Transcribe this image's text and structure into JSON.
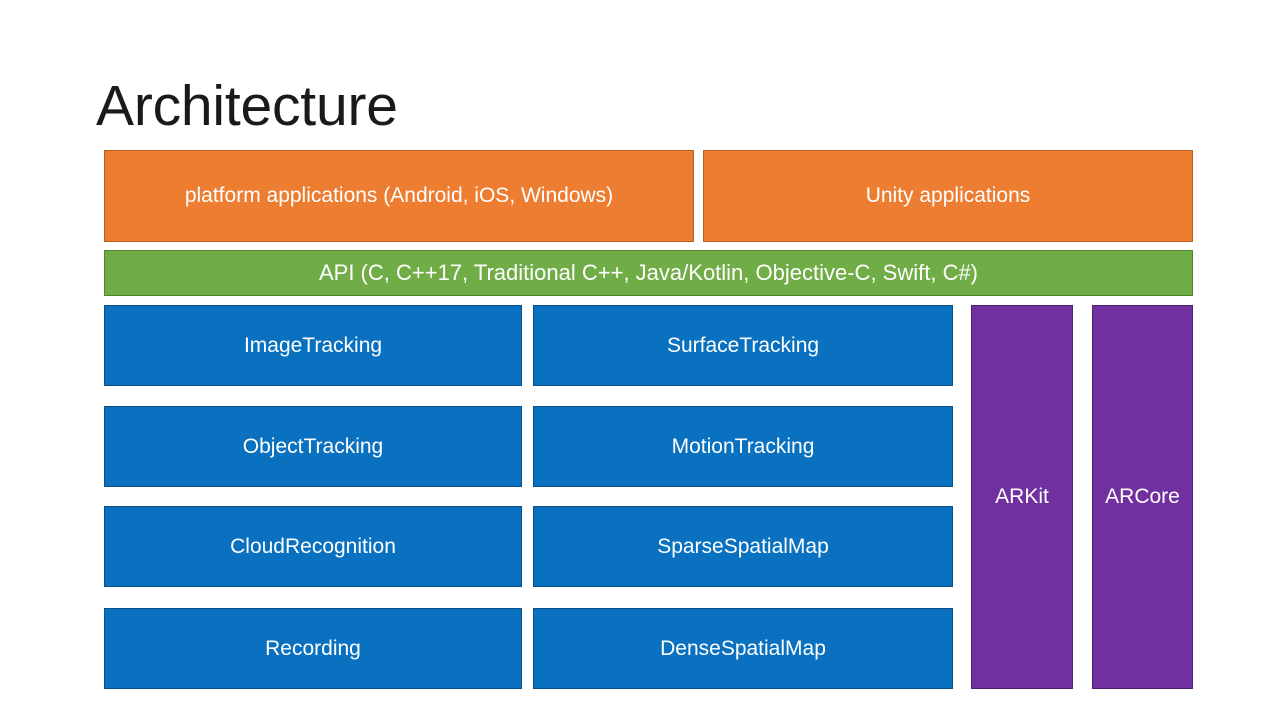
{
  "slide": {
    "title": "Architecture",
    "background_color": "#FFFFFF"
  },
  "palette": {
    "orange": "#ED7D31",
    "green": "#70AD47",
    "blue": "#0A70C0",
    "purple": "#7030A0",
    "text_on_fill": "#FFFFFF",
    "title_color": "#1A1A1A"
  },
  "diagram": {
    "application_tier": {
      "color": "#ED7D31",
      "boxes": [
        {
          "label": "platform applications (Android, iOS, Windows)"
        },
        {
          "label": "Unity applications"
        }
      ]
    },
    "api_tier": {
      "color": "#70AD47",
      "label": "API (C, C++17, Traditional C++, Java/Kotlin, Objective-C, Swift, C#)"
    },
    "feature_tier": {
      "color": "#0A70C0",
      "columns": [
        {
          "boxes": [
            {
              "label": "ImageTracking"
            },
            {
              "label": "ObjectTracking"
            },
            {
              "label": "CloudRecognition"
            },
            {
              "label": "Recording"
            }
          ]
        },
        {
          "boxes": [
            {
              "label": "SurfaceTracking"
            },
            {
              "label": "MotionTracking"
            },
            {
              "label": "SparseSpatialMap"
            },
            {
              "label": "DenseSpatialMap"
            }
          ]
        }
      ]
    },
    "platform_tier": {
      "color": "#7030A0",
      "boxes": [
        {
          "label": "ARKit"
        },
        {
          "label": "ARCore"
        }
      ]
    }
  }
}
